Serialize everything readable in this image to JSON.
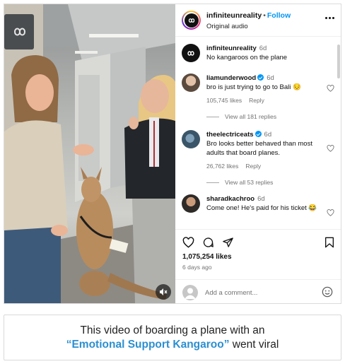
{
  "post": {
    "username": "infiniteunreality",
    "separator": "•",
    "follow_label": "Follow",
    "audio": "Original audio",
    "caption_username": "infiniteunreality",
    "caption_time": "6d",
    "caption_text": "No kangaroos on the plane",
    "likes": "1,075,254 likes",
    "posted_ago": "6 days ago",
    "add_comment_placeholder": "Add a comment..."
  },
  "comments": [
    {
      "username": "liamunderwood",
      "verified": true,
      "time": "6d",
      "text": "bro is just trying to go to Bali 😔",
      "likes": "105,745 likes",
      "reply_label": "Reply",
      "view_replies": "View all 181 replies"
    },
    {
      "username": "theelectriceats",
      "verified": true,
      "time": "6d",
      "text": "Bro looks better behaved than most adults that board planes.",
      "likes": "26,762 likes",
      "reply_label": "Reply",
      "view_replies": "View all 53 replies"
    },
    {
      "username": "sharadkachroo",
      "verified": false,
      "time": "6d",
      "text": "Come one! He's paid for his ticket 😂"
    }
  ],
  "video": {
    "wall_sign_icon": "infinity-icon",
    "mute_icon": "speaker-muted-icon"
  },
  "caption_box": {
    "line1": "This video of boarding a plane with an",
    "highlight": "“Emotional Support Kangaroo”",
    "line2_rest": " went viral"
  },
  "icons": [
    "infinity-logo-icon",
    "more-icon",
    "heart-icon",
    "comment-icon",
    "share-icon",
    "bookmark-icon",
    "emoji-icon"
  ],
  "colors": {
    "follow": "#0095f6",
    "verified": "#0095f6",
    "caption_highlight": "#2c8fd0"
  }
}
